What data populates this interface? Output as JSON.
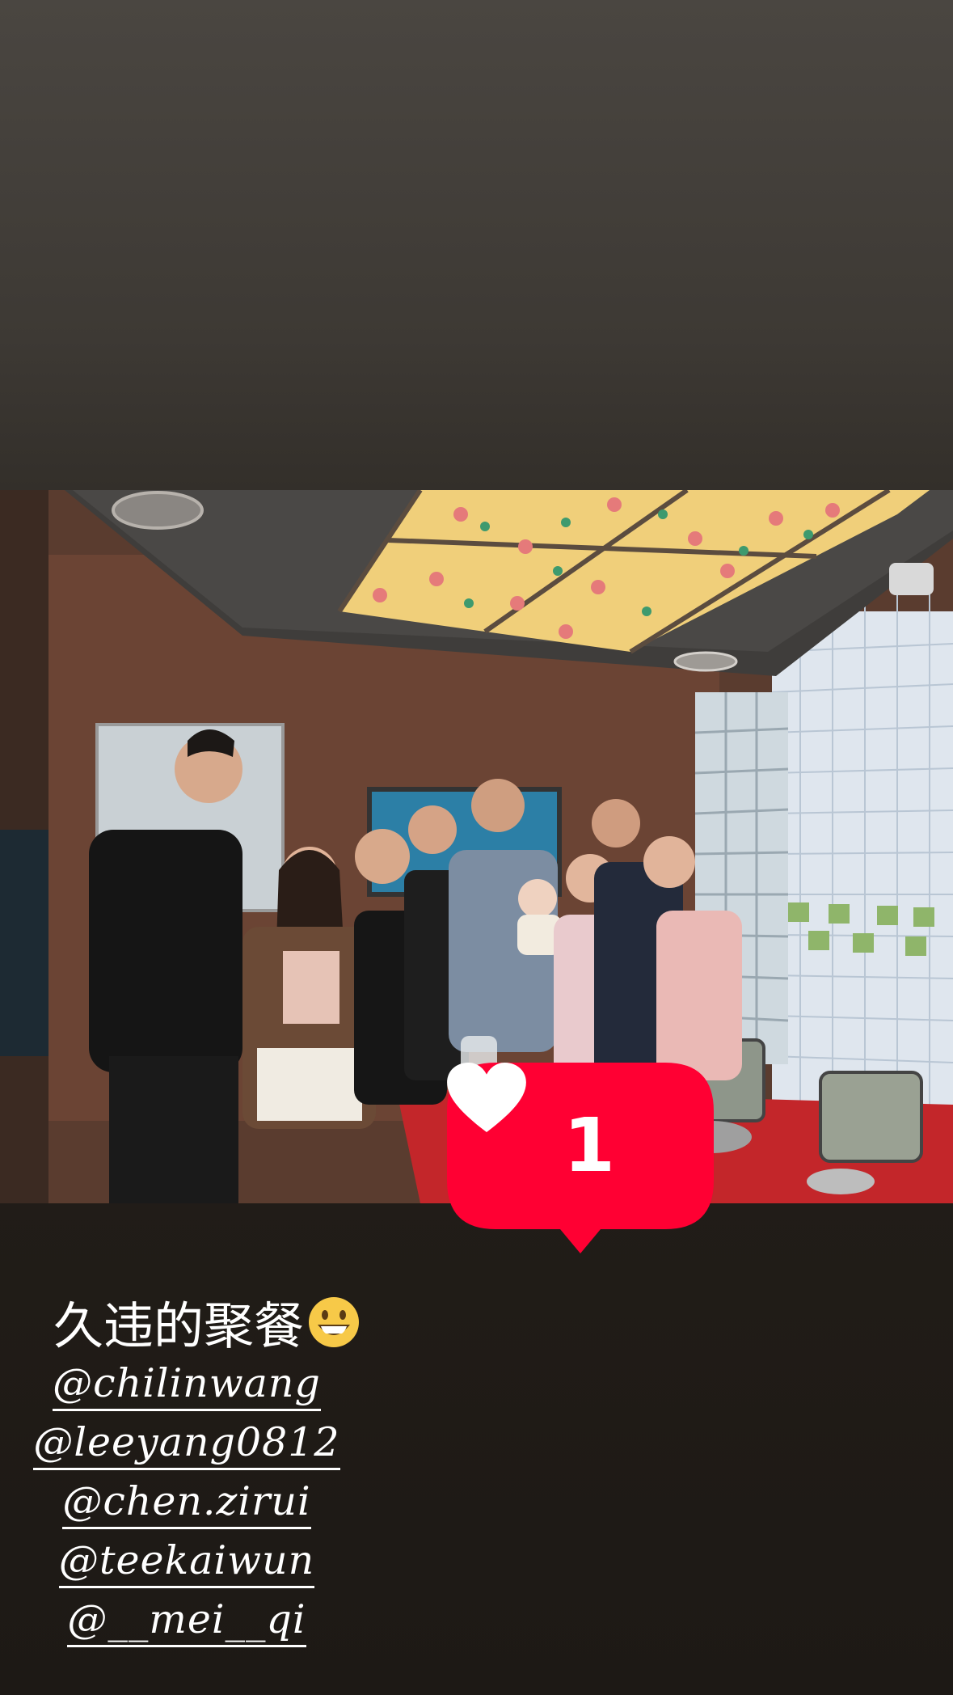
{
  "story": {
    "background_top": "#4a4641",
    "background_bottom": "#1d1915"
  },
  "photo": {
    "description_icon": "group-photo"
  },
  "like_sticker": {
    "count": "1",
    "color": "#ff0033",
    "icon": "heart-icon"
  },
  "caption": {
    "text": "久违的聚餐",
    "emoji": "grinning-face-icon"
  },
  "mentions": [
    "@chilinwang",
    "@leeyang0812",
    "@chen.zirui",
    "@teekaiwun",
    "@__mei__qi"
  ]
}
